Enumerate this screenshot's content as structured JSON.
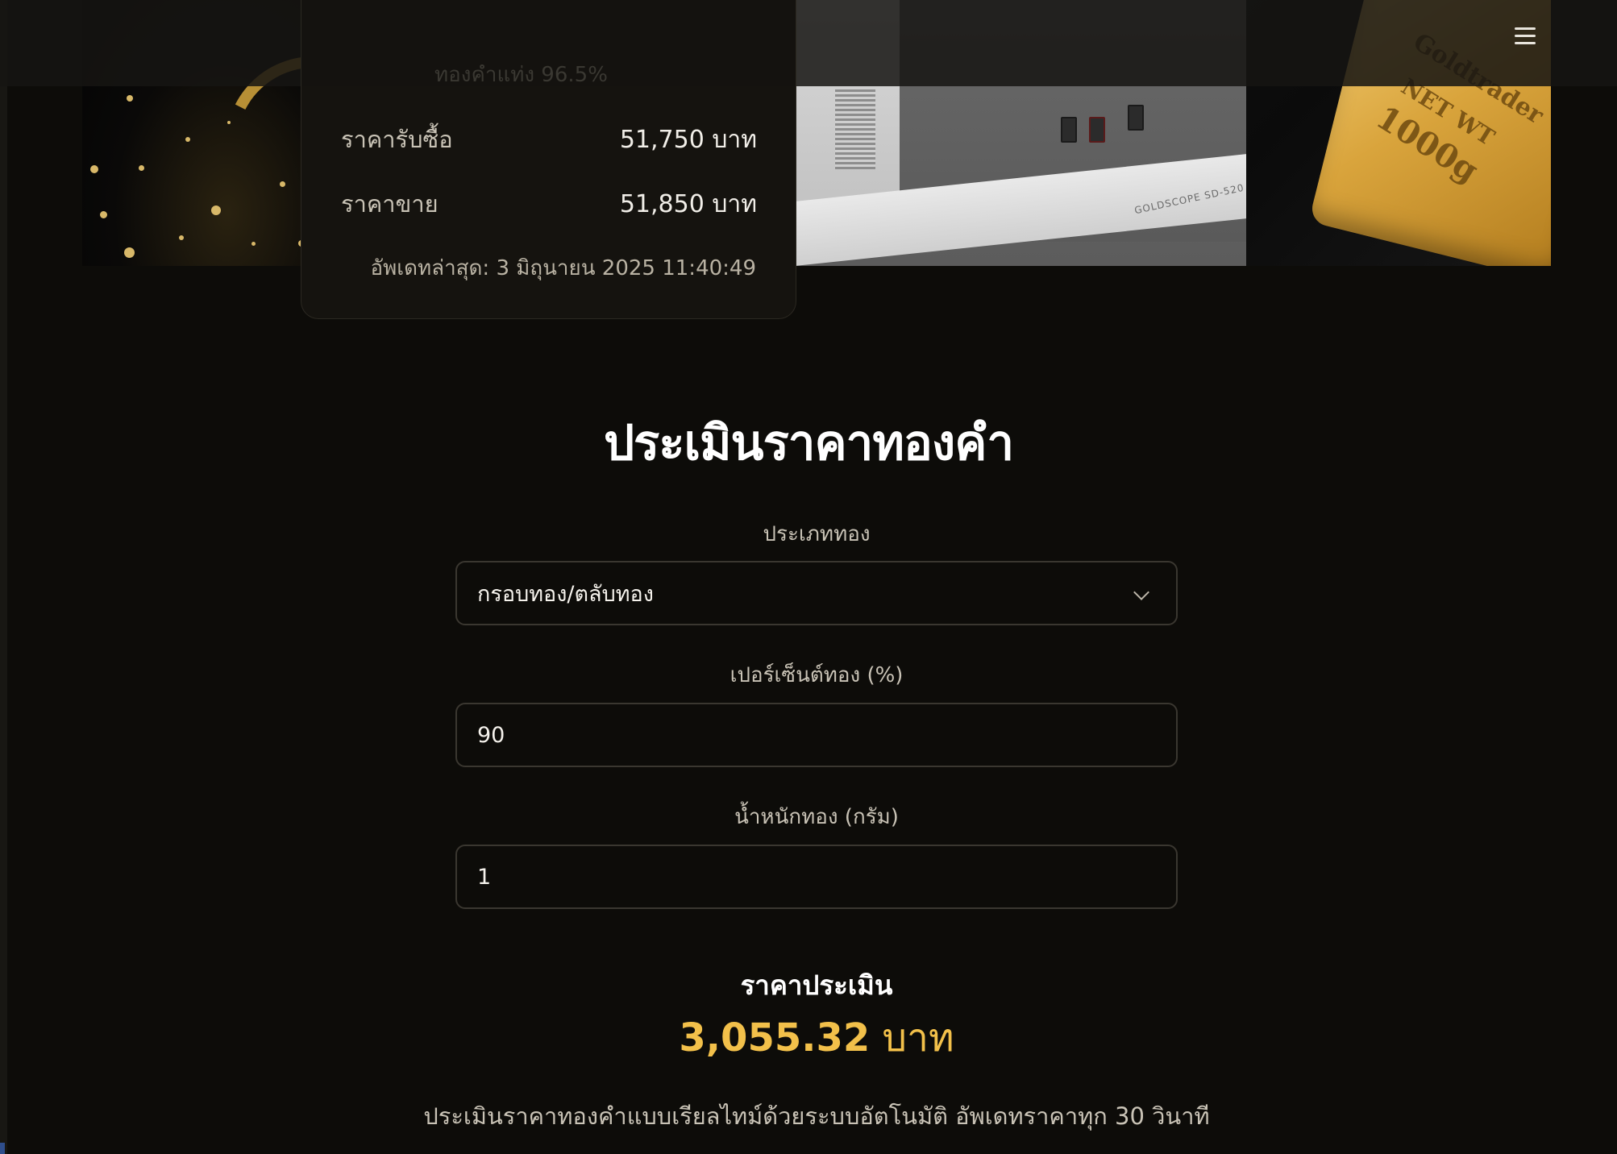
{
  "nav": {
    "menu_icon": "hamburger-menu-icon"
  },
  "hero": {
    "machine_label": "GOLDSCOPE SD-520",
    "goldbar_brand": "Goldtrader",
    "goldbar_netwt": "NET WT",
    "goldbar_weight": "1000g"
  },
  "price_card": {
    "faded_text": "ทองคำแท่ง 96.5%",
    "buy_label": "ราคารับซื้อ",
    "buy_value": "51,750 บาท",
    "sell_label": "ราคาขาย",
    "sell_value": "51,850 บาท",
    "updated": "อัพเดทล่าสุด: 3 มิถุนายน 2025 11:40:49"
  },
  "calculator": {
    "title": "ประเมินราคาทองคำ",
    "gold_type_label": "ประเภททอง",
    "gold_type_value": "กรอบทอง/ตลับทอง",
    "percent_label": "เปอร์เซ็นต์ทอง (%)",
    "percent_value": "90",
    "weight_label": "น้ำหนักทอง (กรัม)",
    "weight_value": "1",
    "result_label": "ราคาประเมิน",
    "result_number": "3,055.32",
    "result_unit": "บาท",
    "footnote": "ประเมินราคาทองคำแบบเรียลไทม์ด้วยระบบอัตโนมัติ อัพเดทราคาทุก 30 วินาที"
  },
  "colors": {
    "background": "#0d0c09",
    "accent_gold": "#f2c04a",
    "card": "#15130f"
  }
}
